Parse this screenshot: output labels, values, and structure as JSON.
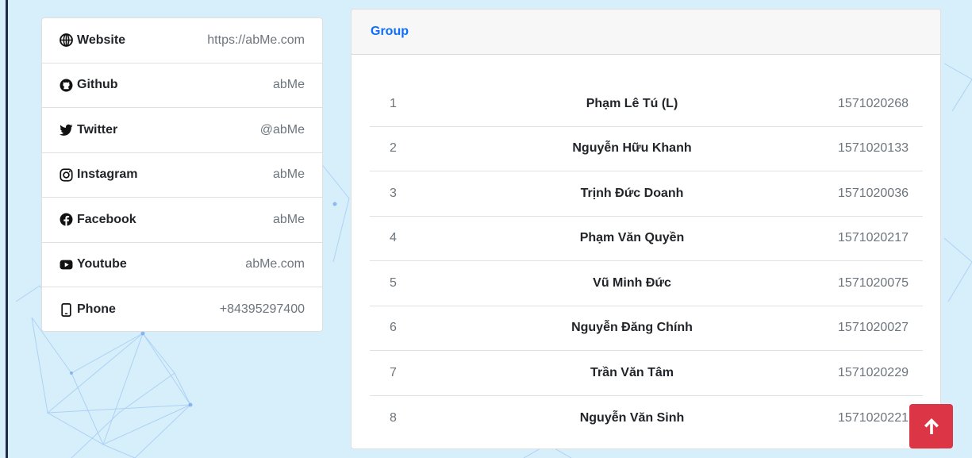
{
  "contacts": [
    {
      "label": "Website",
      "value": "https://abMe.com",
      "icon": "globe-icon"
    },
    {
      "label": "Github",
      "value": "abMe",
      "icon": "github-icon"
    },
    {
      "label": "Twitter",
      "value": "@abMe",
      "icon": "twitter-icon"
    },
    {
      "label": "Instagram",
      "value": "abMe",
      "icon": "instagram-icon"
    },
    {
      "label": "Facebook",
      "value": "abMe",
      "icon": "facebook-icon"
    },
    {
      "label": "Youtube",
      "value": "abMe.com",
      "icon": "youtube-icon"
    },
    {
      "label": "Phone",
      "value": "+84395297400",
      "icon": "phone-icon"
    }
  ],
  "group": {
    "title": "Group",
    "members": [
      {
        "index": "1",
        "name": "Phạm Lê Tú (L)",
        "id": "1571020268"
      },
      {
        "index": "2",
        "name": "Nguyễn Hữu Khanh",
        "id": "1571020133"
      },
      {
        "index": "3",
        "name": "Trịnh Đức Doanh",
        "id": "1571020036"
      },
      {
        "index": "4",
        "name": "Phạm Văn Quyền",
        "id": "1571020217"
      },
      {
        "index": "5",
        "name": "Vũ Minh Đức",
        "id": "1571020075"
      },
      {
        "index": "6",
        "name": "Nguyễn Đăng Chính",
        "id": "1571020027"
      },
      {
        "index": "7",
        "name": "Trần Văn Tâm",
        "id": "1571020229"
      },
      {
        "index": "8",
        "name": "Nguyễn Văn Sinh",
        "id": "1571020221"
      }
    ]
  },
  "scroll_top": {
    "icon": "arrow-up-icon"
  },
  "colors": {
    "accent": "#0d6efd",
    "danger": "#dc3545",
    "background": "#d6effb",
    "muted": "#6c757d"
  }
}
